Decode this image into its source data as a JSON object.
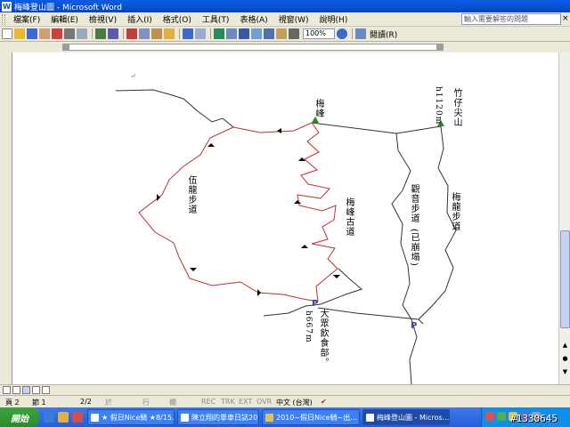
{
  "window": {
    "title": "梅峰登山圖 - Microsoft Word"
  },
  "menu": {
    "items": [
      "檔案(F)",
      "編輯(E)",
      "檢視(V)",
      "插入(I)",
      "格式(O)",
      "工具(T)",
      "表格(A)",
      "視窗(W)",
      "說明(H)"
    ],
    "help_placeholder": "輸入需要解答的問題",
    "close_glyph": "×"
  },
  "toolbar": {
    "zoom": "100%",
    "read_label": "閱讀(R)"
  },
  "document": {
    "labels": {
      "meifeng_peak": "梅峰",
      "zhuzaijian": "竹仔尖山",
      "zhuzaijian_height": "h1120m",
      "wulong_trail": "伍龍步道",
      "guanyin_trail": "觀音步道",
      "guanyin_note": "(已崩塌)",
      "meilong_trail": "梅龍步道",
      "meifeng_old_trail": "梅峰古道",
      "dachen_club": "大眾飲食部。",
      "dachen_height": "h667m",
      "parking_1": "P",
      "parking_2": "P",
      "para_mark": "↵"
    }
  },
  "status": {
    "page": "頁 2",
    "section": "節 1",
    "pages": "2/2",
    "at": "於",
    "line": "行",
    "col": "欄",
    "rec": "REC",
    "trk": "TRK",
    "ext": "EXT",
    "ovr": "OVR",
    "lang": "中文 (台灣)"
  },
  "taskbar": {
    "start": "開始",
    "tasks": [
      "★ 假日Nice騎 ★8/15...",
      "陳立翔的單車日誌20...",
      "2010~假日Nice騎~出...",
      "梅峰登山圖 - Micros..."
    ]
  },
  "watermark": "#1330645"
}
